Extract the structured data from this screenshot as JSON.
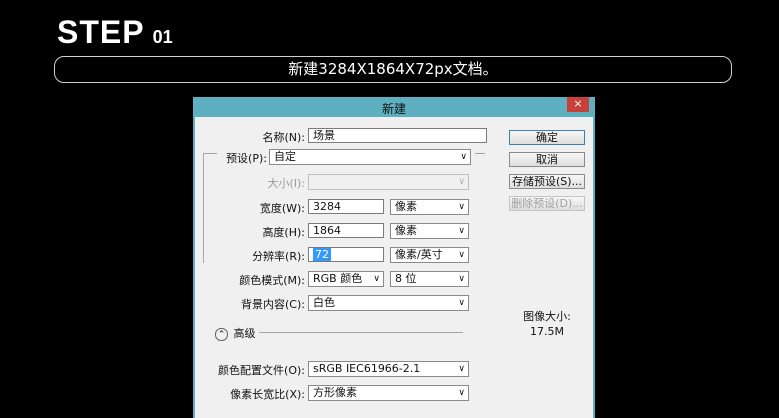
{
  "header": {
    "step_word": "STEP",
    "step_number": "01",
    "caption": "新建3284X1864X72px文档。"
  },
  "dialog": {
    "title": "新建",
    "close_glyph": "×",
    "fields": {
      "name": {
        "label": "名称(N):",
        "value": "场景"
      },
      "preset": {
        "label": "预设(P):",
        "value": "自定"
      },
      "size": {
        "label": "大小(I):",
        "value": ""
      },
      "width": {
        "label": "宽度(W):",
        "value": "3284",
        "unit": "像素"
      },
      "height": {
        "label": "高度(H):",
        "value": "1864",
        "unit": "像素"
      },
      "resolution": {
        "label": "分辨率(R):",
        "value": "72",
        "unit": "像素/英寸"
      },
      "color_mode": {
        "label": "颜色模式(M):",
        "value": "RGB 颜色",
        "bits": "8 位"
      },
      "background": {
        "label": "背景内容(C):",
        "value": "白色"
      },
      "advanced": {
        "label": "高级",
        "icon": "⌃"
      },
      "color_profile": {
        "label": "颜色配置文件(O):",
        "value": "sRGB IEC61966-2.1"
      },
      "pixel_aspect": {
        "label": "像素长宽比(X):",
        "value": "方形像素"
      }
    },
    "buttons": {
      "ok": "确定",
      "cancel": "取消",
      "save_preset": "存储预设(S)...",
      "delete_preset": "删除预设(D)..."
    },
    "image_size": {
      "label": "图像大小:",
      "value": "17.5M"
    }
  }
}
